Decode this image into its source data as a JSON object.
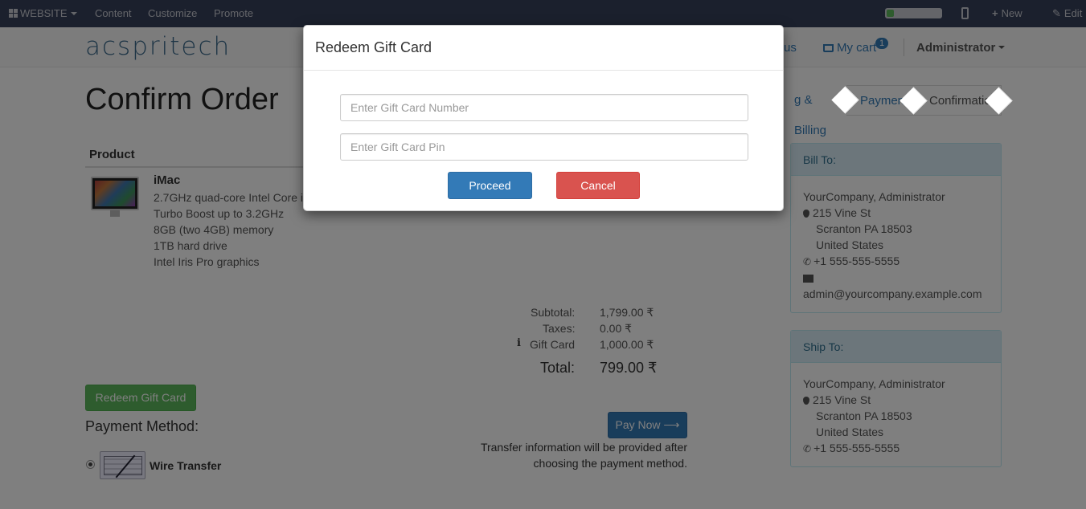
{
  "adminbar": {
    "website_label": "WEBSITE",
    "content_label": "Content",
    "customize_label": "Customize",
    "promote_label": "Promote",
    "new_label": "New",
    "edit_label": "Edit"
  },
  "header": {
    "logo_text": "acspritech",
    "contact_partial": "us",
    "cart_label": "My cart",
    "cart_count": "1",
    "user_label": "Administrator"
  },
  "page": {
    "title": "Confirm Order"
  },
  "steps": [
    {
      "label": "g & Billing",
      "state": "done"
    },
    {
      "label": "Payment",
      "state": "done"
    },
    {
      "label": "Confirmation",
      "state": "pending"
    }
  ],
  "table": {
    "product_header": "Product"
  },
  "product": {
    "name": "iMac",
    "desc": [
      "2.7GHz quad-core Intel Core i",
      "Turbo Boost up to 3.2GHz",
      "8GB (two 4GB) memory",
      "1TB hard drive",
      "Intel Iris Pro graphics"
    ]
  },
  "totals": {
    "subtotal_label": "Subtotal:",
    "subtotal_value": "1,799.00 ₹",
    "taxes_label": "Taxes:",
    "taxes_value": "0.00 ₹",
    "giftcard_label": "Gift Card",
    "giftcard_value": "1,000.00 ₹",
    "total_label": "Total:",
    "total_value": "799.00 ₹"
  },
  "payment": {
    "redeem_button": "Redeem Gift Card",
    "method_title": "Payment Method:",
    "method_name": "Wire Transfer",
    "paynow_label": "Pay Now ⟶",
    "transfer_note_1": "Transfer information will be provided after",
    "transfer_note_2": "choosing the payment method."
  },
  "bill_to": {
    "heading": "Bill To:",
    "name": "YourCompany, Administrator",
    "street": "215 Vine St",
    "city": "Scranton PA 18503",
    "country": "United States",
    "phone": "+1 555-555-5555",
    "email": "admin@yourcompany.example.com"
  },
  "ship_to": {
    "heading": "Ship To:",
    "name": "YourCompany, Administrator",
    "street": "215 Vine St",
    "city": "Scranton PA 18503",
    "country": "United States",
    "phone": "+1 555-555-5555"
  },
  "modal": {
    "title": "Redeem Gift Card",
    "card_number_placeholder": "Enter Gift Card Number",
    "card_pin_placeholder": "Enter Gift Card Pin",
    "proceed_label": "Proceed",
    "cancel_label": "Cancel"
  },
  "colors": {
    "primary": "#337ab7",
    "success": "#5cb85c",
    "danger": "#d9534f",
    "adminbar": "#37405b",
    "panel_heading": "#d9edf7"
  }
}
